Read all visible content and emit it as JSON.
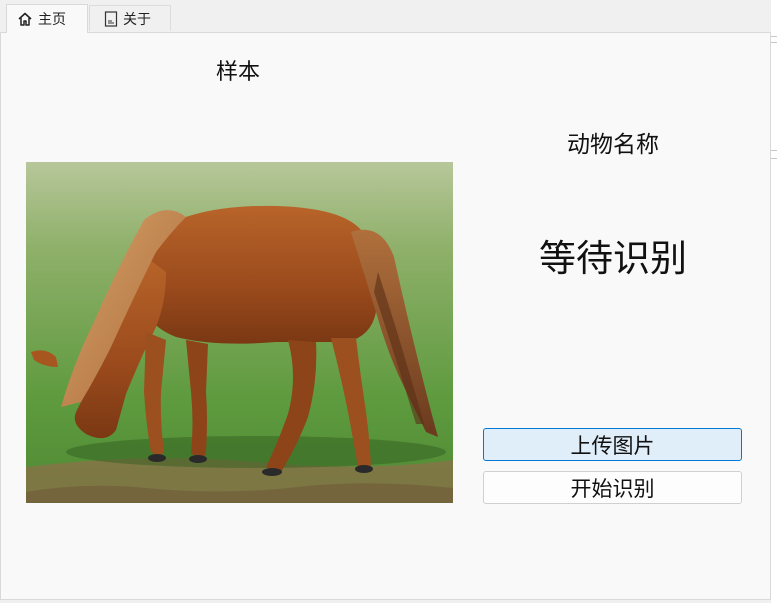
{
  "tabs": [
    {
      "label": "主页",
      "icon": "home-icon",
      "active": true
    },
    {
      "label": "关于",
      "icon": "document-icon",
      "active": false
    }
  ],
  "main": {
    "sample_label": "样本",
    "image_subject": "horse-photo",
    "name_label": "动物名称",
    "result_text": "等待识别",
    "upload_button": "上传图片",
    "recognize_button": "开始识别"
  },
  "colors": {
    "accent": "#0078d4",
    "upload_button_bg": "#e0eef9",
    "panel_bg": "#f9f9f9",
    "window_bg": "#f0f0f0"
  }
}
